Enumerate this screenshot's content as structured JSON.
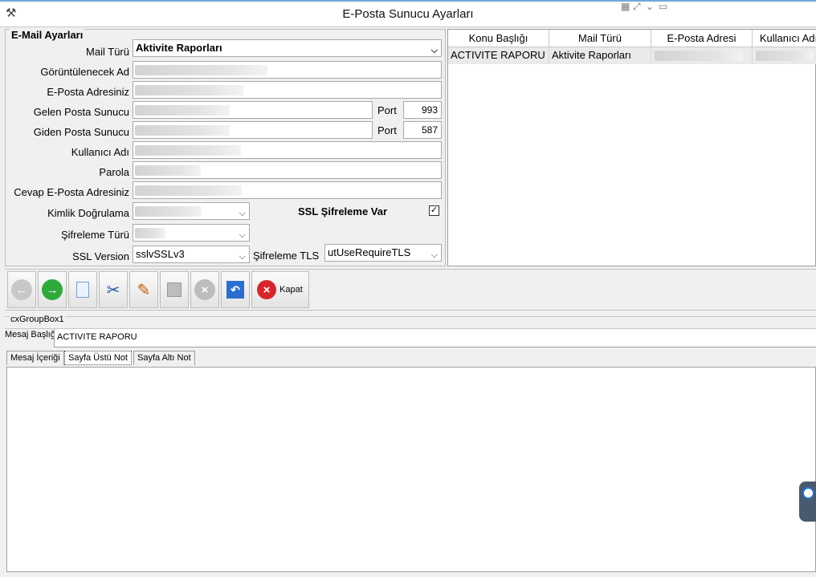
{
  "window": {
    "title": "E-Posta Sunucu Ayarları"
  },
  "settings": {
    "group_title": "E-Mail Ayarları",
    "mail_turu": {
      "label": "Mail Türü",
      "value": "Aktivite Raporları"
    },
    "gorunen_ad": {
      "label": "Görüntülenecek Ad"
    },
    "eposta": {
      "label": "E-Posta Adresiniz"
    },
    "gelen": {
      "label": "Gelen Posta Sunucu",
      "port_label": "Port",
      "port": "993"
    },
    "giden": {
      "label": "Giden Posta Sunucu",
      "port_label": "Port",
      "port": "587"
    },
    "kullanici": {
      "label": "Kullanıcı Adı"
    },
    "parola": {
      "label": "Parola"
    },
    "cevap": {
      "label": "Cevap E-Posta Adresiniz"
    },
    "kimlik": {
      "label": "Kimlik Doğrulama"
    },
    "ssl_sifreleme": {
      "label": "SSL Şifreleme Var",
      "checked": true
    },
    "sifreleme_turu": {
      "label": "Şifreleme Türü"
    },
    "ssl_version": {
      "label": "SSL Version",
      "value": "sslvSSLv3"
    },
    "sifreleme_tls": {
      "label": "Şifreleme TLS",
      "value": "utUseRequireTLS"
    }
  },
  "grid": {
    "columns": [
      "Konu Başlığı",
      "Mail Türü",
      "E-Posta Adresi",
      "Kullanıcı Adı"
    ],
    "rows": [
      [
        "ACTIVITE RAPORU",
        "Aktivite Raporları",
        "",
        ""
      ]
    ]
  },
  "toolbar": {
    "close_label": "Kapat"
  },
  "bottom": {
    "group_caption": "cxGroupBox1",
    "subject_label": "Mesaj Başlığı",
    "subject_value": "ACTIVITE RAPORU",
    "tabs": [
      "Mesaj İçeriği",
      "Sayfa Üstü Not",
      "Sayfa Altı Not"
    ]
  }
}
